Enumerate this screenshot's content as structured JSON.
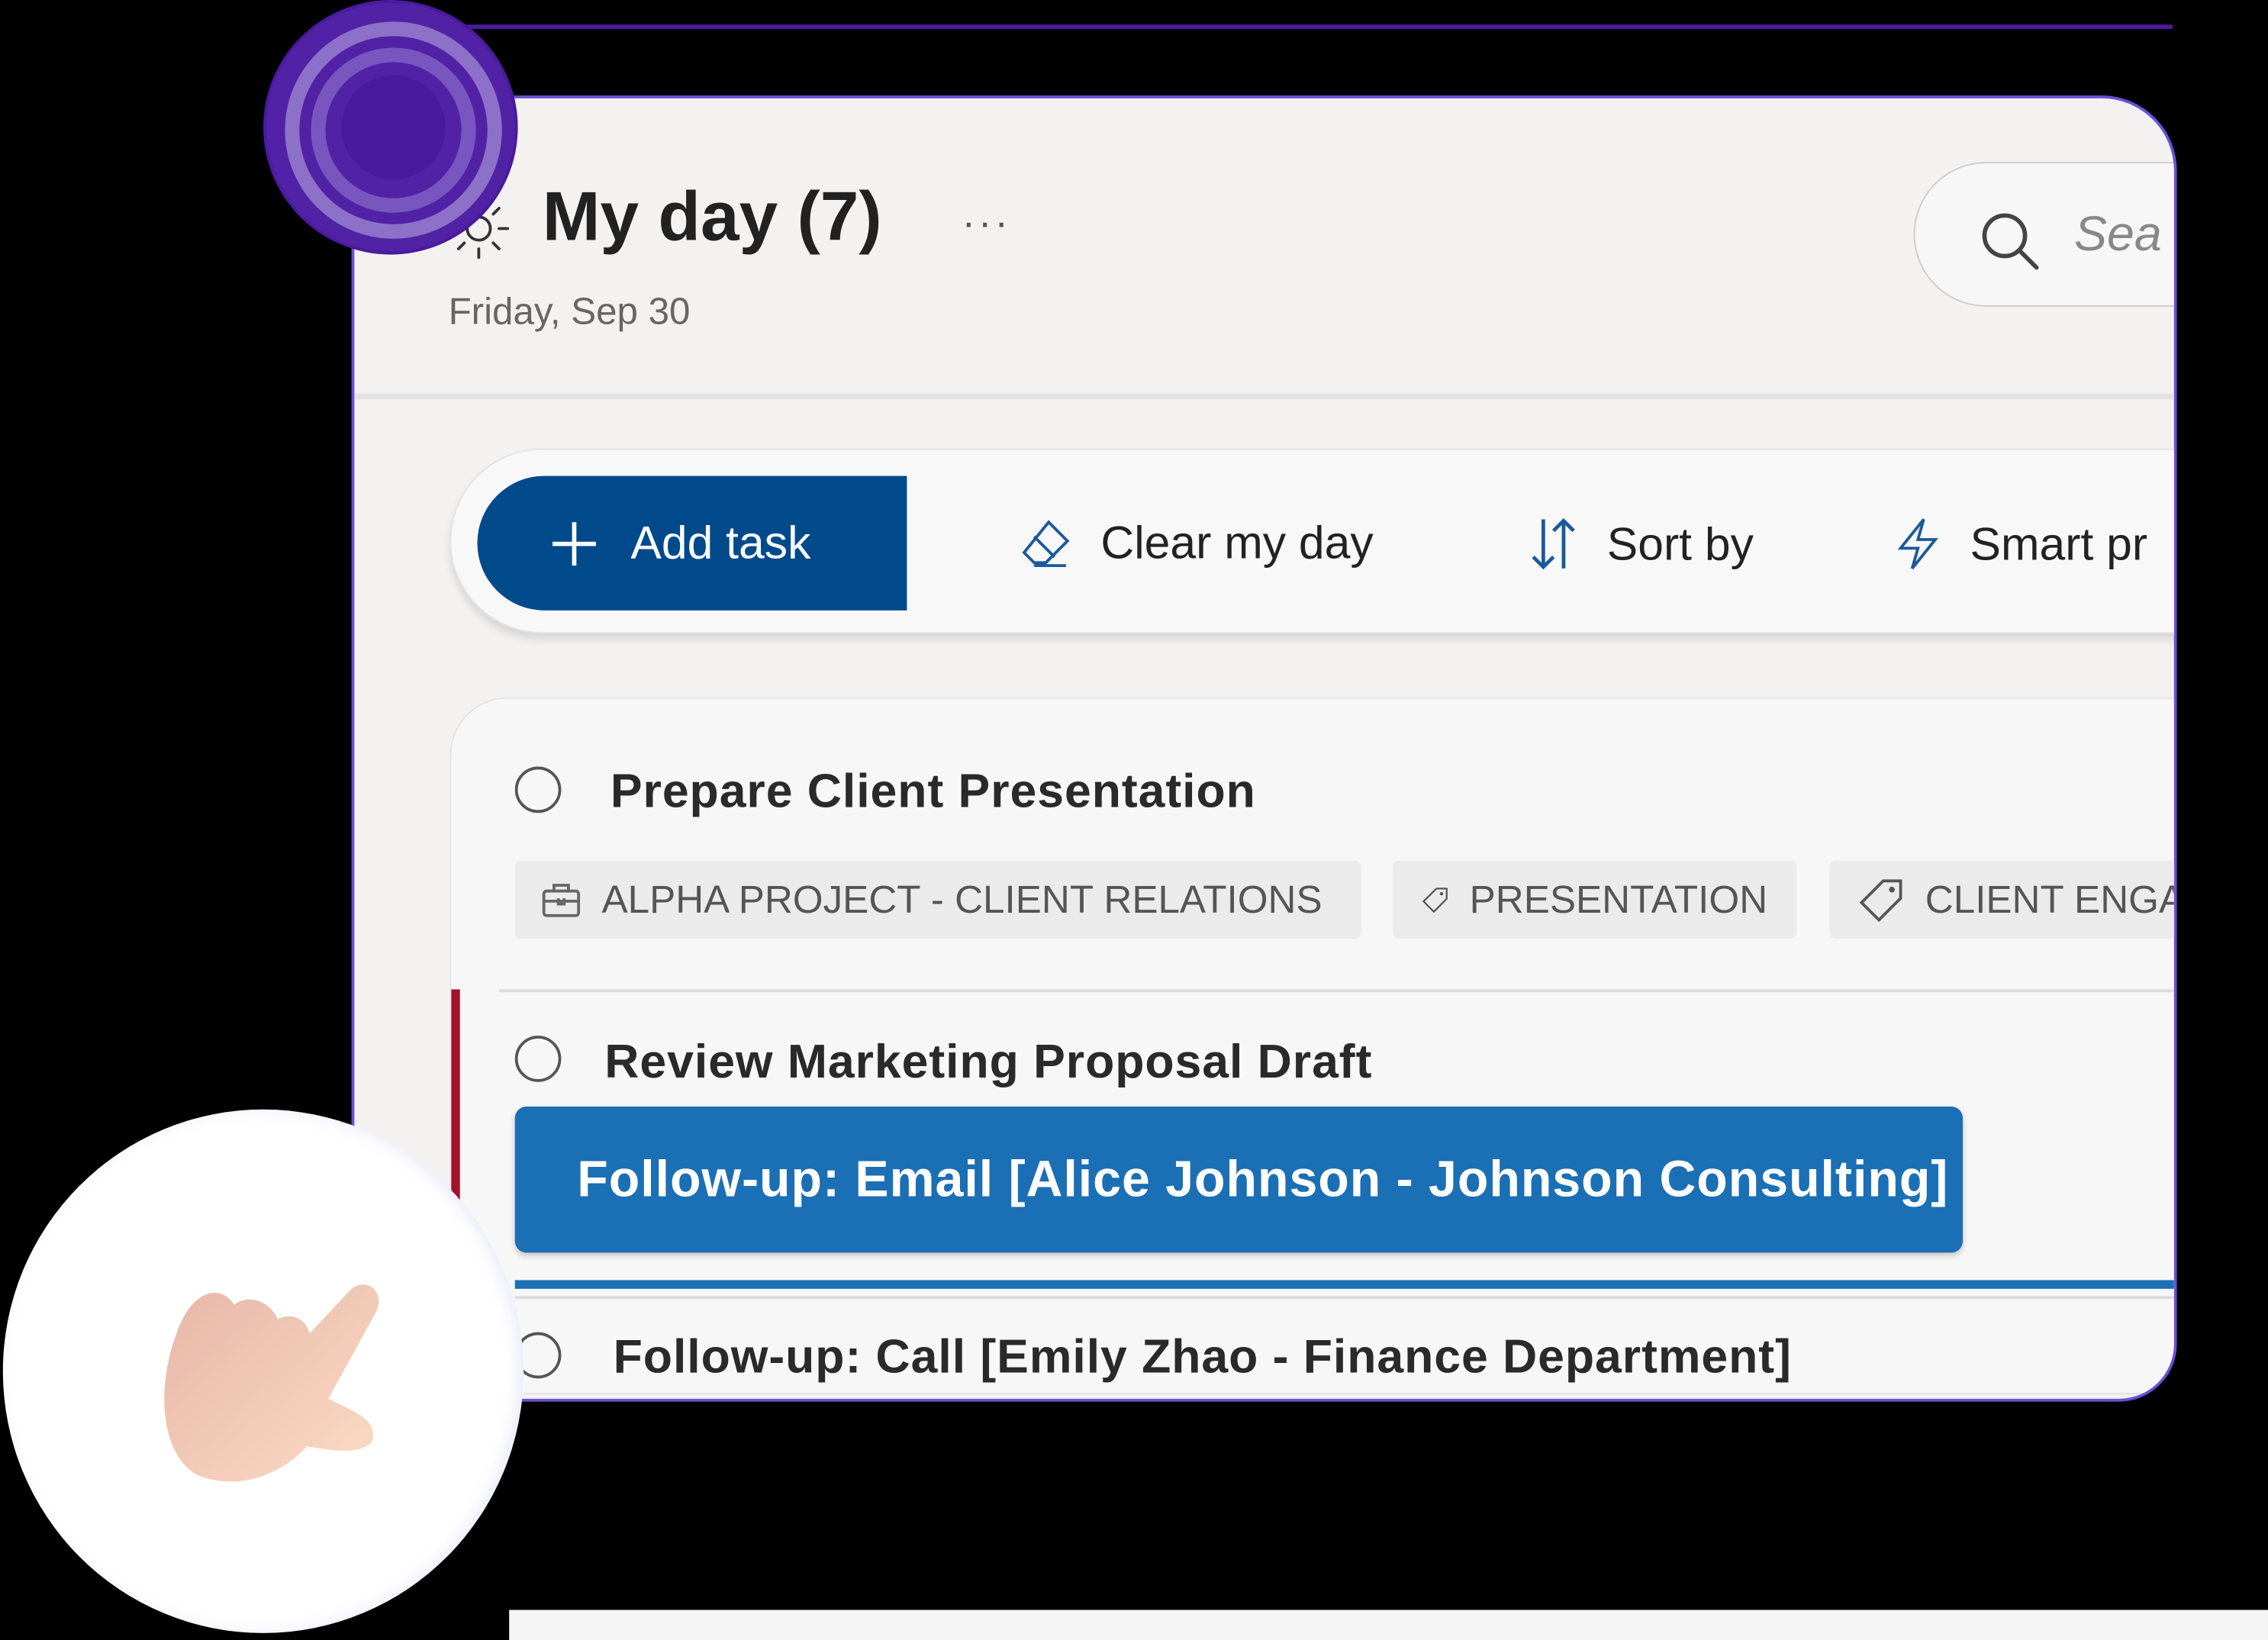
{
  "header": {
    "title": "My day (7)",
    "more_label": "···",
    "date": "Friday, Sep 30",
    "icon": "sun-icon"
  },
  "search": {
    "placeholder": "Sea"
  },
  "toolbar": {
    "add_task": "Add task",
    "clear_my_day": "Clear my day",
    "sort_by": "Sort by",
    "smart": "Smart pr"
  },
  "tasks": [
    {
      "title": "Prepare Client Presentation",
      "chips": [
        "ALPHA PROJECT - CLIENT RELATIONS",
        "PRESENTATION",
        "CLIENT ENGAG"
      ]
    },
    {
      "title": "Review Marketing Proposal Draft",
      "highlight": "Follow-up: Email [Alice Johnson - Johnson Consulting]"
    },
    {
      "title": "Follow-up: Call [Emily Zhao - Finance Department]"
    }
  ],
  "colors": {
    "accent": "#004a8c",
    "highlight": "#1b6fb5",
    "frame": "#6b4fd8",
    "priority": "#a3122a"
  }
}
